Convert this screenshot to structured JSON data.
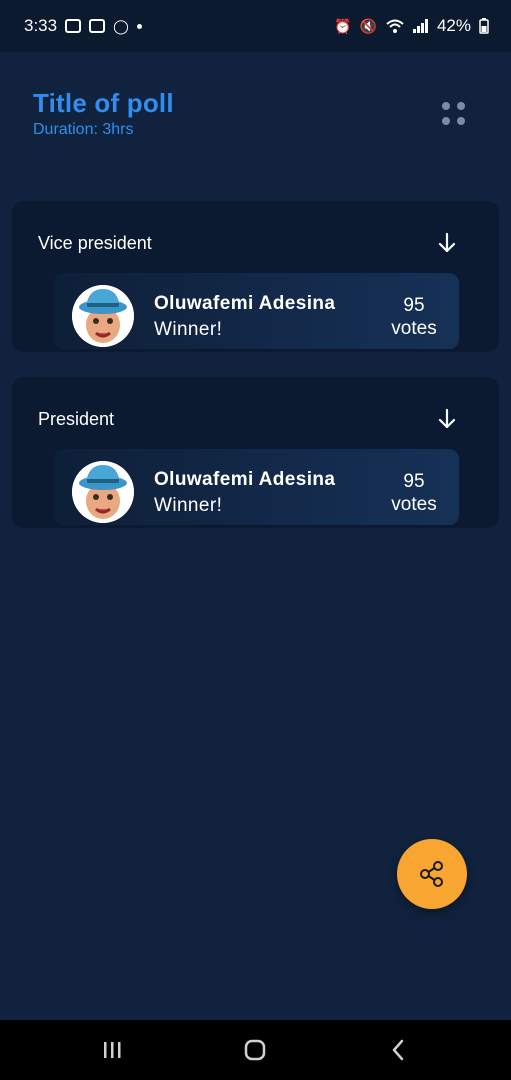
{
  "status_bar": {
    "time": "3:33",
    "battery": "42%"
  },
  "poll": {
    "title": "Title of poll",
    "duration": "Duration: 3hrs"
  },
  "sections": [
    {
      "title": "Vice president",
      "candidate": {
        "name": "Oluwafemi Adesina",
        "status": "Winner!",
        "votes": "95",
        "votes_label": "votes"
      }
    },
    {
      "title": "President",
      "candidate": {
        "name": "Oluwafemi Adesina",
        "status": "Winner!",
        "votes": "95",
        "votes_label": "votes"
      }
    }
  ],
  "icons": {
    "more": "grid-dots-icon",
    "expand": "arrow-down-icon",
    "share": "share-icon"
  },
  "colors": {
    "background": "#10223d",
    "title_blue": "#2f8ef0",
    "fab": "#f8a532",
    "section": "#0b1a30"
  }
}
